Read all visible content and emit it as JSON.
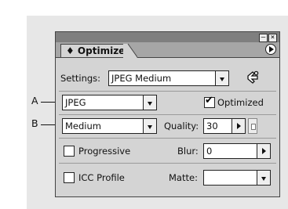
{
  "panel": {
    "tab_label": "♦ Optimize",
    "window_buttons": [
      "–",
      "×"
    ],
    "settings_label": "Settings:",
    "settings_value": "JPEG Medium",
    "format_value": "JPEG",
    "optimized_label": "Optimized",
    "optimized_checked": true,
    "quality_preset": "Medium",
    "quality_label": "Quality:",
    "quality_value": "30",
    "progressive_label": "Progressive",
    "progressive_checked": false,
    "blur_label": "Blur:",
    "blur_value": "0",
    "icc_label": "ICC Profile",
    "icc_checked": false,
    "matte_label": "Matte:",
    "matte_value": ""
  },
  "callouts": {
    "a": "A",
    "b": "B"
  }
}
